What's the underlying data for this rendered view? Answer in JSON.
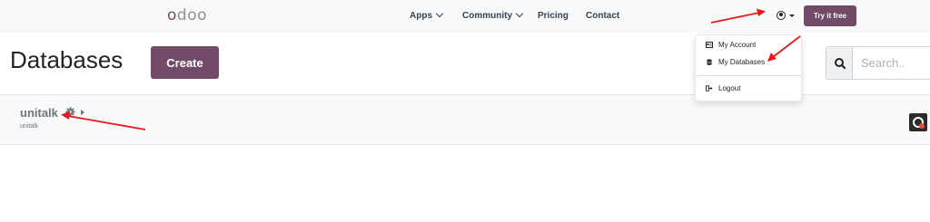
{
  "header": {
    "logo": "odoo",
    "nav": [
      {
        "label": "Apps",
        "has_caret": true
      },
      {
        "label": "Community",
        "has_caret": true
      },
      {
        "label": "Pricing",
        "has_caret": false
      },
      {
        "label": "Contact",
        "has_caret": false
      }
    ],
    "try_button": "Try it free",
    "user_icon": "user-circle-icon"
  },
  "user_menu": {
    "items": [
      {
        "label": "My Account",
        "icon": "id-card-icon"
      },
      {
        "label": "My Databases",
        "icon": "database-icon"
      },
      {
        "label": "Logout",
        "icon": "sign-out-icon"
      }
    ]
  },
  "main": {
    "title": "Databases",
    "create_button": "Create",
    "search": {
      "placeholder": "Search..",
      "icon": "search-icon"
    }
  },
  "databases": [
    {
      "name": "unitalk",
      "subtitle": "unitalk"
    }
  ],
  "colors": {
    "brand": "#714b67",
    "annotation_arrow": "#e8191a",
    "header_bg": "#f8f9fa"
  }
}
